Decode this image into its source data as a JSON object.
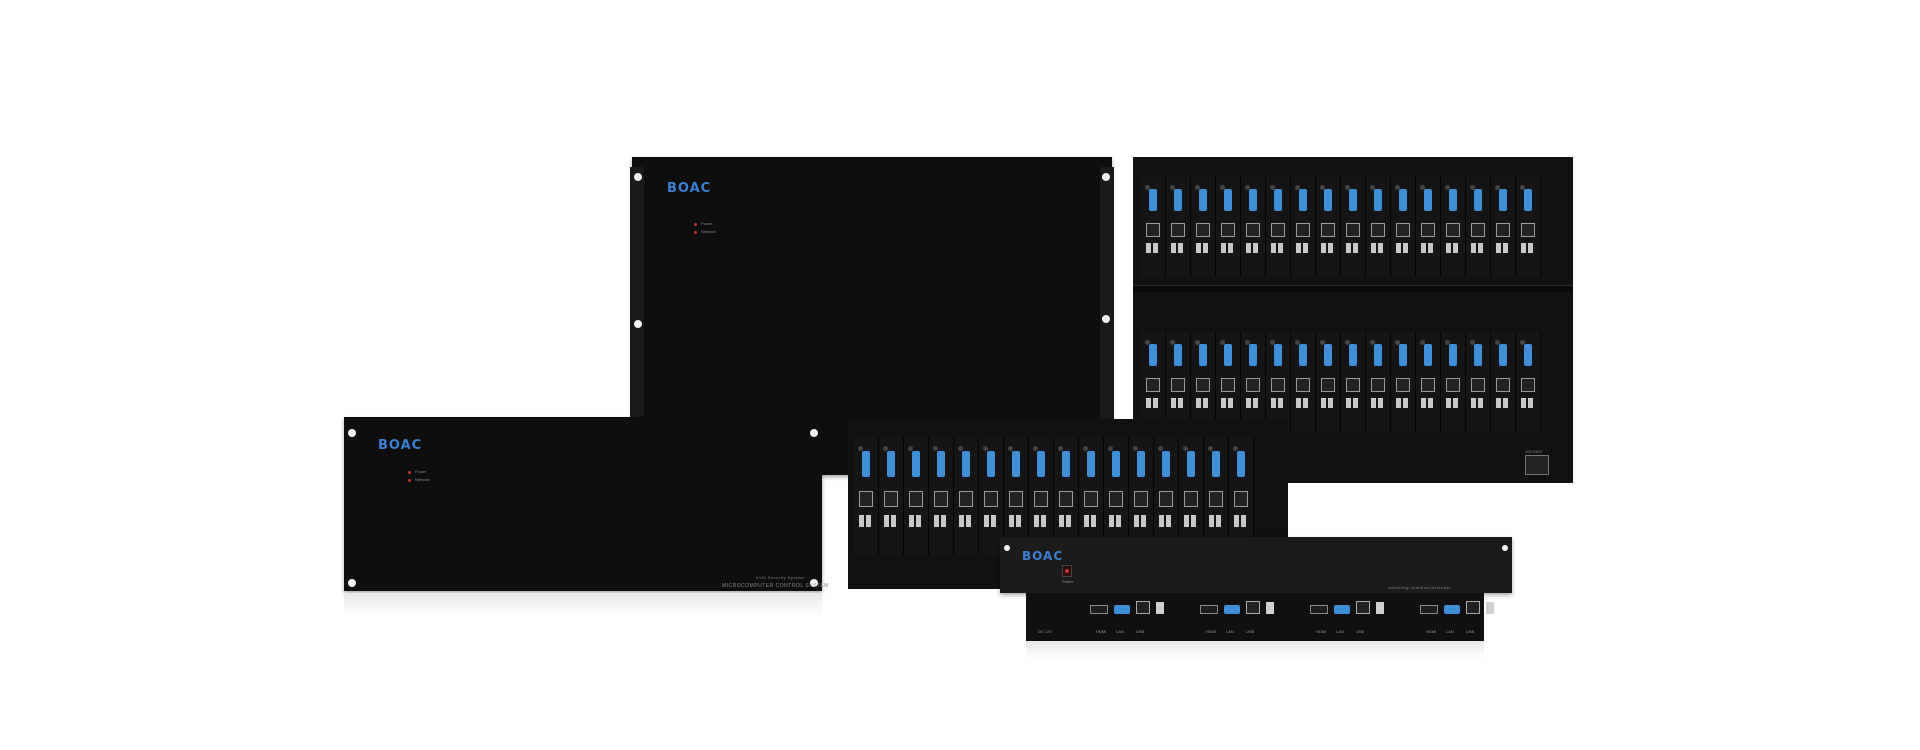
{
  "scene": "product-lineup",
  "brand": {
    "logo_text": "BOAC",
    "logo_color": "#3b7fd1"
  },
  "chassis_large": {
    "led_labels": [
      "Power",
      "Network"
    ]
  },
  "chassis_medium": {
    "led_labels": [
      "Power",
      "Network"
    ],
    "subtitle": "KVM Security System",
    "model_text": "MICROCOMPUTER CONTROL SYSTEM"
  },
  "rack_cards_top": {
    "count": 16
  },
  "rack_cards_bottom": {
    "count": 16
  },
  "rack_cards_mid": {
    "count": 16
  },
  "power_label": "100-240V",
  "rackmount_1u": {
    "led_label": "Power",
    "url_text": "switching.com/kvm/extender"
  },
  "extender": {
    "port_groups": 4,
    "dc_label": "DC 12V",
    "labels": [
      "HDMI",
      "LAN",
      "USB"
    ]
  },
  "colors": {
    "body": "#0e0e0f",
    "vga_blue": "#3f8fd8"
  }
}
